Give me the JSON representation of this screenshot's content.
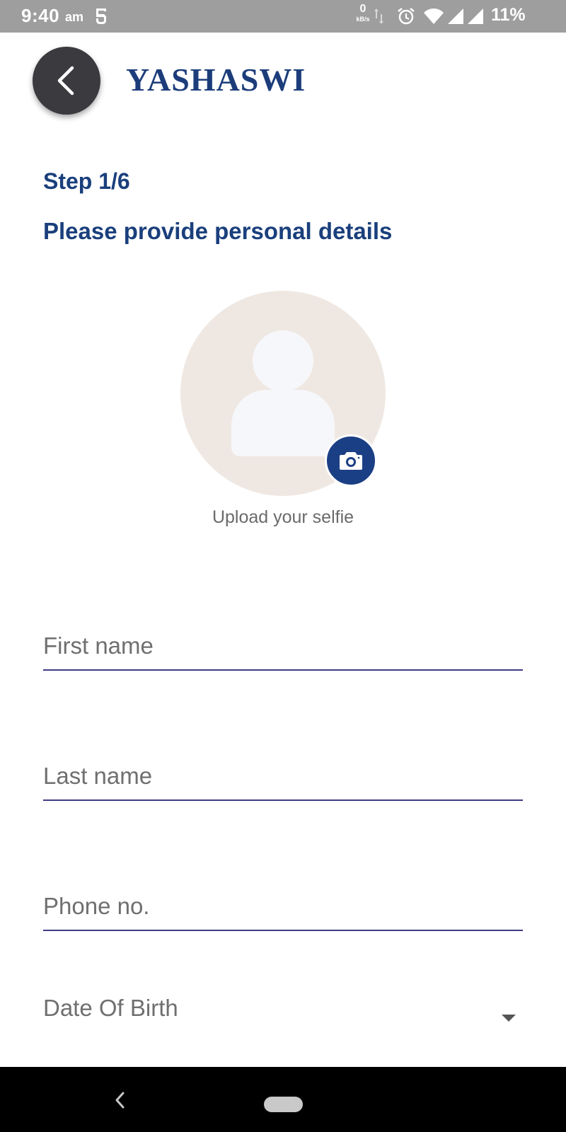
{
  "status_bar": {
    "time": "9:40",
    "ampm": "am",
    "net_speed_value": "0",
    "net_speed_unit": "kB/s",
    "battery": "11%",
    "icons": [
      "app-notification-icon",
      "data-arrows-icon",
      "alarm-icon",
      "wifi-icon",
      "signal-icon",
      "signal-icon"
    ]
  },
  "header": {
    "back_icon": "chevron-left-icon",
    "brand": "YASHASWI"
  },
  "form": {
    "step": "Step 1/6",
    "subtitle": "Please provide personal details",
    "selfie": {
      "camera_icon": "camera-icon",
      "label": "Upload your selfie"
    },
    "fields": {
      "first_name": {
        "placeholder": "First name",
        "value": ""
      },
      "last_name": {
        "placeholder": "Last name",
        "value": ""
      },
      "phone": {
        "placeholder": "Phone no.",
        "value": ""
      },
      "dob": {
        "label": "Date Of Birth",
        "icon": "dropdown-arrow-icon"
      }
    }
  },
  "nav_bar": {
    "back_icon": "nav-back-icon",
    "home_icon": "nav-home-pill"
  },
  "colors": {
    "accent": "#1a3f7c",
    "camera_button": "#1b3f84",
    "underline": "#3f3b84",
    "avatar_bg": "#efe8e2",
    "status_bar": "#9e9e9e"
  }
}
